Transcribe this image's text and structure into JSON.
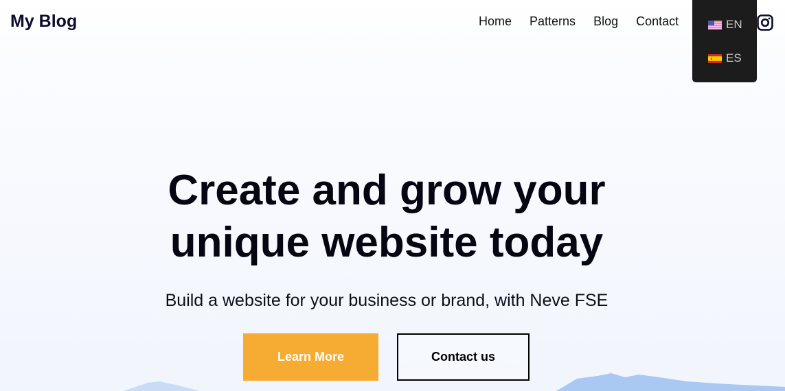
{
  "header": {
    "logo": "My Blog",
    "nav": [
      "Home",
      "Patterns",
      "Blog",
      "Contact"
    ],
    "social_icon": "instagram-icon"
  },
  "language_menu": {
    "items": [
      {
        "code": "EN",
        "flag": "us-flag-icon"
      },
      {
        "code": "ES",
        "flag": "spain-flag-icon"
      }
    ]
  },
  "hero": {
    "title_line1": "Create and grow your",
    "title_line2": "unique website today",
    "subtitle": "Build a website for your business or brand, with Neve FSE",
    "primary_button": "Learn More",
    "secondary_button": "Contact us"
  },
  "colors": {
    "accent": "#f6ab33",
    "menu_bg": "#1c1c1c",
    "text": "#0c0c26"
  }
}
